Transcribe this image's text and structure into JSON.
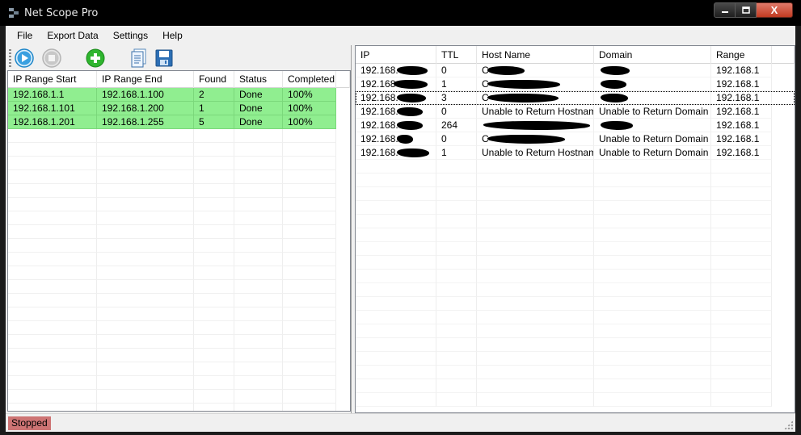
{
  "window": {
    "title": "Net Scope Pro",
    "caption_buttons": {
      "minimize": "▁",
      "maximize": "□",
      "close": "X"
    }
  },
  "menu": [
    "File",
    "Export Data",
    "Settings",
    "Help"
  ],
  "toolbar": {
    "icons": [
      "play-icon",
      "stop-icon",
      "add-icon",
      "document-icon",
      "save-icon"
    ]
  },
  "ranges_table": {
    "columns": [
      "IP Range Start",
      "IP Range End",
      "Found",
      "Status",
      "Completed"
    ],
    "rows": [
      [
        "192.168.1.1",
        "192.168.1.100",
        "2",
        "Done",
        "100%"
      ],
      [
        "192.168.1.101",
        "192.168.1.200",
        "1",
        "Done",
        "100%"
      ],
      [
        "192.168.1.201",
        "192.168.1.255",
        "5",
        "Done",
        "100%"
      ]
    ],
    "row_color": "#90ee90"
  },
  "results_table": {
    "columns": [
      "IP",
      "TTL",
      "Host Name",
      "Domain",
      "Range"
    ],
    "rows": [
      [
        "192.168.",
        "0",
        "C",
        "",
        "192.168.1"
      ],
      [
        "192.168",
        "1",
        "C",
        "",
        "192.168.1"
      ],
      [
        "192.168.",
        "3",
        "C",
        "",
        "192.168.1"
      ],
      [
        "192.168.",
        "0",
        "Unable to Return Hostname",
        "Unable to Return Domain",
        "192.168.1"
      ],
      [
        "192.168.",
        "264",
        "",
        "",
        "192.168.1"
      ],
      [
        "192.168.",
        "0",
        "C",
        "Unable to Return Domain",
        "192.168.1"
      ],
      [
        "192.168.",
        "1",
        "Unable to Return Hostname",
        "Unable to Return Domain",
        "192.168.1"
      ]
    ]
  },
  "status": {
    "text": "Stopped",
    "color": "#cd7474"
  }
}
